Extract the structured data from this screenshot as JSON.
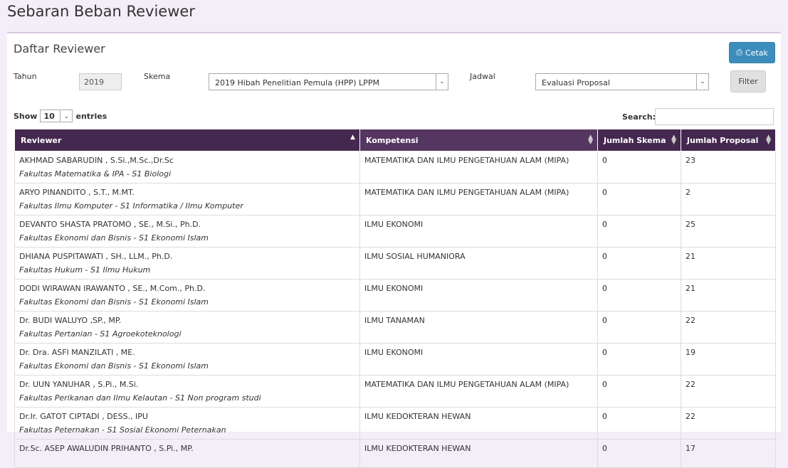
{
  "page_title": "Sebaran Beban Reviewer",
  "panel_title": "Daftar Reviewer",
  "print_button": "Cetak",
  "filters": {
    "tahun_label": "Tahun",
    "tahun_value": "2019",
    "skema_label": "Skema",
    "skema_value": "2019 Hibah Penelitian Pemula (HPP) LPPM",
    "jadwal_label": "Jadwal",
    "jadwal_value": "Evaluasi Proposal",
    "filter_button": "Filter"
  },
  "length": {
    "show": "Show",
    "value": "10",
    "entries": "entries"
  },
  "search_label": "Search:",
  "columns": [
    "Reviewer",
    "Kompetensi",
    "Jumlah Skema",
    "Jumlah Proposal"
  ],
  "rows": [
    {
      "name": "AKHMAD SABARUDIN , S.Si.,M.Sc.,Dr.Sc",
      "faculty": "Fakultas Matematika & IPA - S1 Biologi",
      "kompetensi": "MATEMATIKA DAN ILMU PENGETAHUAN ALAM (MIPA)",
      "skema": "0",
      "proposal": "23"
    },
    {
      "name": "ARYO PINANDITO , S.T., M.MT.",
      "faculty": "Fakultas Ilmu Komputer - S1 Informatika / Ilmu Komputer",
      "kompetensi": "MATEMATIKA DAN ILMU PENGETAHUAN ALAM (MIPA)",
      "skema": "0",
      "proposal": "2"
    },
    {
      "name": "DEVANTO SHASTA PRATOMO , SE., M.Si., Ph.D.",
      "faculty": "Fakultas Ekonomi dan Bisnis - S1 Ekonomi Islam",
      "kompetensi": "ILMU EKONOMI",
      "skema": "0",
      "proposal": "25"
    },
    {
      "name": "DHIANA PUSPITAWATI , SH., LLM., Ph.D.",
      "faculty": "Fakultas Hukum - S1 Ilmu Hukum",
      "kompetensi": "ILMU SOSIAL HUMANIORA",
      "skema": "0",
      "proposal": "21"
    },
    {
      "name": "DODI WIRAWAN IRAWANTO , SE., M.Com., Ph.D.",
      "faculty": "Fakultas Ekonomi dan Bisnis - S1 Ekonomi Islam",
      "kompetensi": "ILMU EKONOMI",
      "skema": "0",
      "proposal": "21"
    },
    {
      "name": "Dr. BUDI WALUYO ,SP., MP.",
      "faculty": "Fakultas Pertanian - S1 Agroekoteknologi",
      "kompetensi": "ILMU TANAMAN",
      "skema": "0",
      "proposal": "22"
    },
    {
      "name": "Dr. Dra. ASFI MANZILATI , ME.",
      "faculty": "Fakultas Ekonomi dan Bisnis - S1 Ekonomi Islam",
      "kompetensi": "ILMU EKONOMI",
      "skema": "0",
      "proposal": "19"
    },
    {
      "name": "Dr. UUN YANUHAR , S.Pi., M.Si.",
      "faculty": "Fakultas Perikanan dan Ilmu Kelautan - S1 Non program studi",
      "kompetensi": "MATEMATIKA DAN ILMU PENGETAHUAN ALAM (MIPA)",
      "skema": "0",
      "proposal": "22"
    },
    {
      "name": "Dr.Ir. GATOT CIPTADI , DESS., IPU",
      "faculty": "Fakultas Peternakan - S1 Sosial Ekonomi Peternakan",
      "kompetensi": "ILMU KEDOKTERAN HEWAN",
      "skema": "0",
      "proposal": "22"
    },
    {
      "name": "Dr.Sc. ASEP AWALUDIN PRIHANTO , S.Pi., MP.",
      "faculty": "",
      "kompetensi": "ILMU KEDOKTERAN HEWAN",
      "skema": "0",
      "proposal": "17"
    }
  ]
}
